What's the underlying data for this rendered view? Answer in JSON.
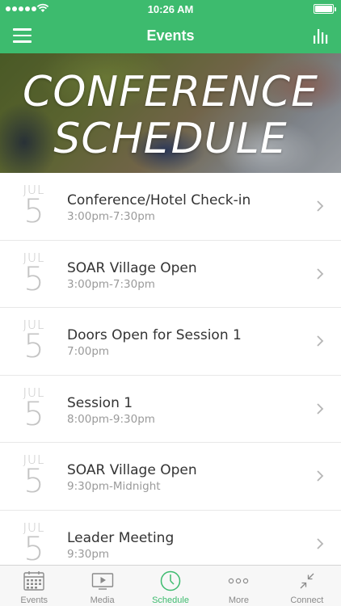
{
  "status_bar": {
    "time": "10:26 AM"
  },
  "nav": {
    "title": "Events"
  },
  "hero": {
    "line1": "CONFERENCE",
    "line2": "SCHEDULE"
  },
  "events": [
    {
      "month": "JUL",
      "day": "5",
      "title": "Conference/Hotel Check-in",
      "time": "3:00pm-7:30pm"
    },
    {
      "month": "JUL",
      "day": "5",
      "title": "SOAR Village Open",
      "time": "3:00pm-7:30pm"
    },
    {
      "month": "JUL",
      "day": "5",
      "title": "Doors Open for Session 1",
      "time": "7:00pm"
    },
    {
      "month": "JUL",
      "day": "5",
      "title": "Session 1",
      "time": "8:00pm-9:30pm"
    },
    {
      "month": "JUL",
      "day": "5",
      "title": "SOAR Village Open",
      "time": "9:30pm-Midnight"
    },
    {
      "month": "JUL",
      "day": "5",
      "title": "Leader Meeting",
      "time": "9:30pm"
    }
  ],
  "tabs": [
    {
      "label": "Events",
      "icon": "calendar-icon",
      "active": false
    },
    {
      "label": "Media",
      "icon": "media-player-icon",
      "active": false
    },
    {
      "label": "Schedule",
      "icon": "clock-icon",
      "active": true
    },
    {
      "label": "More",
      "icon": "more-dots-icon",
      "active": false
    },
    {
      "label": "Connect",
      "icon": "connect-arrows-icon",
      "active": false
    }
  ],
  "colors": {
    "accent": "#3dbb6e",
    "tab_inactive": "#8a8a8a",
    "date_gray": "#c4c4c4"
  }
}
